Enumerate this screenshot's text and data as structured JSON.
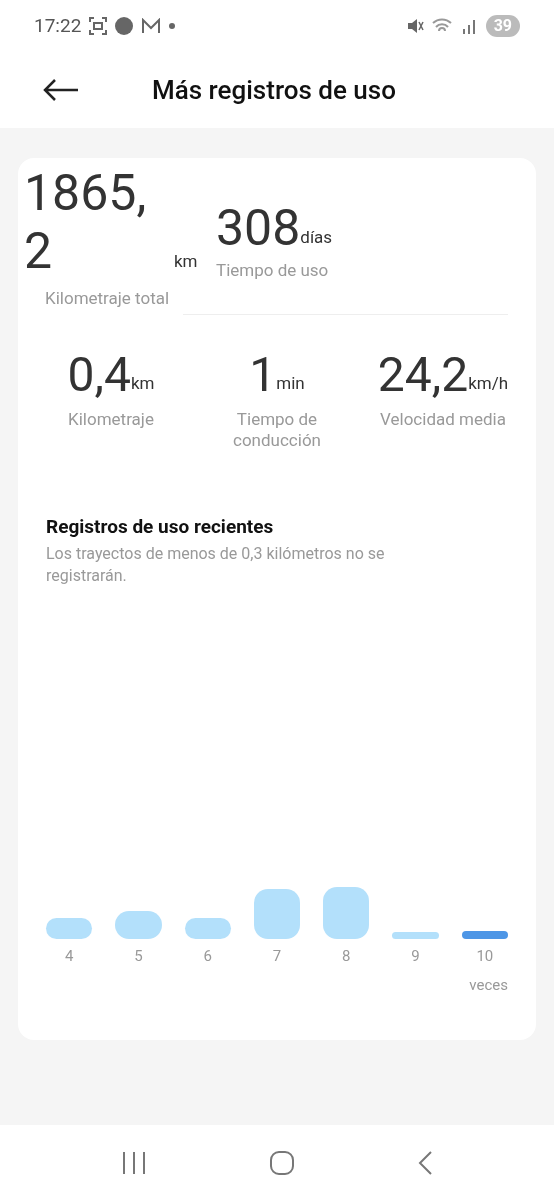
{
  "status_bar": {
    "time": "17:22",
    "battery": "39"
  },
  "header": {
    "title": "Más registros de uso"
  },
  "totals": [
    {
      "value": "1865,2",
      "unit": "km",
      "label": "Kilometraje total"
    },
    {
      "value": "308",
      "unit": "días",
      "label": "Tiempo de uso"
    }
  ],
  "stats": [
    {
      "value": "0,4",
      "unit": "km",
      "label": "Kilometraje"
    },
    {
      "value": "1",
      "unit": "min",
      "label": "Tiempo de conducción"
    },
    {
      "value": "24,2",
      "unit": "km/h",
      "label": "Velocidad media"
    }
  ],
  "recent": {
    "title": "Registros de uso recientes",
    "note": "Los trayectos de menos de 0,3 kilómetros no se registrarán.",
    "unit": "veces",
    "bars": [
      {
        "label": "4",
        "selected": false
      },
      {
        "label": "5",
        "selected": false
      },
      {
        "label": "6",
        "selected": false
      },
      {
        "label": "7",
        "selected": false
      },
      {
        "label": "8",
        "selected": false
      },
      {
        "label": "9",
        "selected": false
      },
      {
        "label": "10",
        "selected": true
      }
    ]
  }
}
